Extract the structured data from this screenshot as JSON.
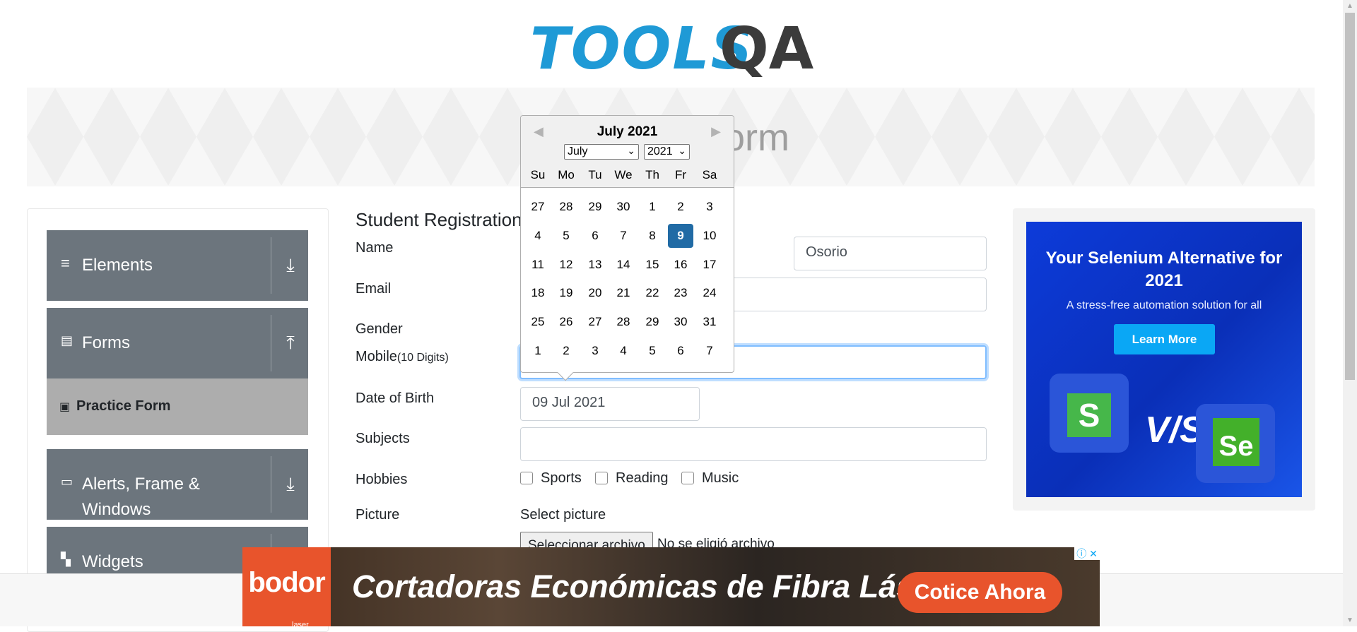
{
  "logo": {
    "text": "TOOLS",
    "qa": "QA"
  },
  "banner": {
    "title": "Practice Form"
  },
  "sidebar": {
    "groups": [
      {
        "label": "Elements",
        "icon": "hamburger-icon",
        "arrow": "download-icon"
      },
      {
        "label": "Forms",
        "icon": "document-icon",
        "arrow": "upload-icon"
      },
      {
        "label": "Alerts, Frame & Windows",
        "icon": "window-icon",
        "arrow": "download-icon"
      },
      {
        "label": "Widgets",
        "icon": "widgets-icon",
        "arrow": "download-icon"
      }
    ],
    "active_item": {
      "label": "Practice Form",
      "icon": "form-icon"
    },
    "glyphs": {
      "hamburger": "≡",
      "doc": "▤",
      "window": "▭",
      "widgets": "▚",
      "down": "⤓",
      "up": "⤒",
      "form": "▣"
    }
  },
  "form": {
    "title": "Student Registration Form",
    "labels": {
      "name": "Name",
      "email": "Email",
      "gender": "Gender",
      "mobile": "Mobile",
      "mobile_hint": "(10 Digits)",
      "dob": "Date of Birth",
      "subjects": "Subjects",
      "hobbies": "Hobbies",
      "picture": "Picture"
    },
    "last_name_value": "Osorio",
    "dob_value": "09 Jul 2021",
    "hobbies": [
      "Sports",
      "Reading",
      "Music"
    ],
    "picture_label": "Select picture",
    "file_button": "Seleccionar archivo",
    "file_status": "No se eligió archivo"
  },
  "datepicker": {
    "title": "July 2021",
    "month_select": "July",
    "year_select": "2021",
    "weekdays": [
      "Su",
      "Mo",
      "Tu",
      "We",
      "Th",
      "Fr",
      "Sa"
    ],
    "weeks": [
      [
        "27",
        "28",
        "29",
        "30",
        "1",
        "2",
        "3"
      ],
      [
        "4",
        "5",
        "6",
        "7",
        "8",
        "9",
        "10"
      ],
      [
        "11",
        "12",
        "13",
        "14",
        "15",
        "16",
        "17"
      ],
      [
        "18",
        "19",
        "20",
        "21",
        "22",
        "23",
        "24"
      ],
      [
        "25",
        "26",
        "27",
        "28",
        "29",
        "30",
        "31"
      ],
      [
        "1",
        "2",
        "3",
        "4",
        "5",
        "6",
        "7"
      ]
    ],
    "selected": "9",
    "nav_prev": "◀",
    "nav_next": "▶",
    "caret": "⌄"
  },
  "ad_right": {
    "title": "Your Selenium Alternative for 2021",
    "subtitle": "A stress-free automation solution for all",
    "button": "Learn More",
    "vs": "V/S",
    "logo1": "S",
    "logo2": "Se"
  },
  "ad_bottom": {
    "brand": "bodor",
    "brand_sub": "laser",
    "headline": "Cortadoras Económicas de Fibra Láser",
    "cta": "Cotice Ahora",
    "close": "ⓘ ✕"
  },
  "colors": {
    "accent": "#216ba5",
    "sidebar": "#6c757d",
    "active_item": "#adadad",
    "focus": "#80bdff"
  }
}
